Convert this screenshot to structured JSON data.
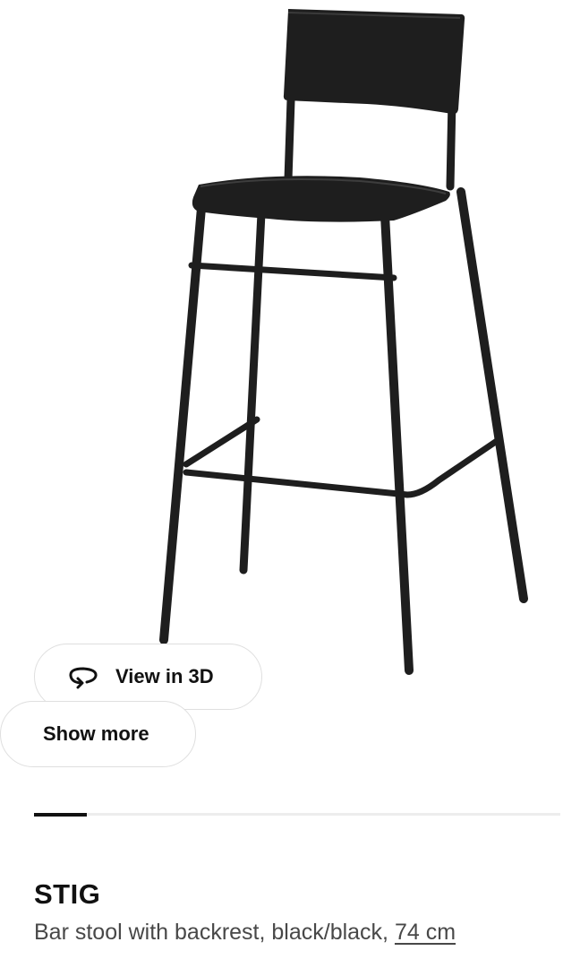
{
  "product": {
    "image_icon": "bar-stool-image",
    "name": "STIG",
    "description": "Bar stool with backrest, black/black,",
    "size": "74 cm"
  },
  "buttons": {
    "view_3d_label": "View in 3D",
    "view_3d_icon": "rotate-3d-icon",
    "show_more_label": "Show more"
  },
  "gallery_progress": 0.1,
  "colors": {
    "stool": "#1e1e1e",
    "text_primary": "#111111",
    "text_secondary": "#484848",
    "pill_border": "#dfdfdf",
    "progress_track": "#ededed",
    "progress_fill": "#111111"
  }
}
